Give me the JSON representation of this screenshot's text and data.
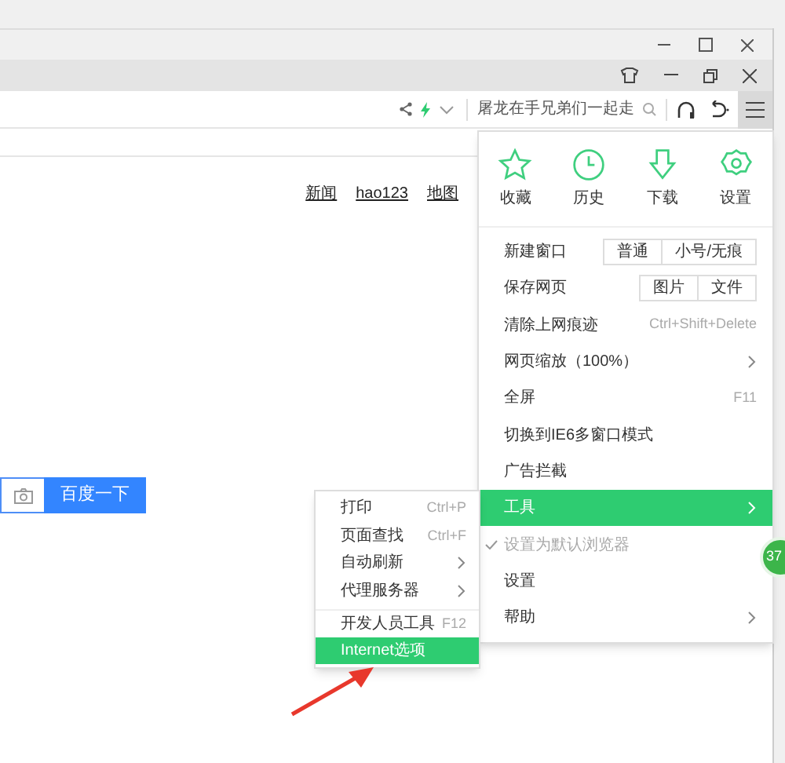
{
  "toolbar": {
    "search_text": "屠龙在手兄弟们一起走",
    "menu_button": {
      "selected": true
    }
  },
  "page": {
    "links": [
      "新闻",
      "hao123",
      "地图"
    ],
    "search_button": "百度一下"
  },
  "main_menu": {
    "shortcuts": [
      {
        "kind": "star",
        "label": "收藏"
      },
      {
        "kind": "clock",
        "label": "历史"
      },
      {
        "kind": "download",
        "label": "下载"
      },
      {
        "kind": "gear",
        "label": "设置"
      }
    ],
    "items": [
      {
        "label": "新建窗口",
        "buttons": [
          "普通",
          "小号/无痕"
        ],
        "selected": false
      },
      {
        "label": "保存网页",
        "buttons": [
          "图片",
          "文件"
        ],
        "selected": false
      },
      {
        "label": "清除上网痕迹",
        "shortcut": "Ctrl+Shift+Delete",
        "selected": false
      },
      {
        "label": "网页缩放（100%）",
        "submenu": true,
        "selected": false
      },
      {
        "label": "全屏",
        "shortcut": "F11",
        "selected": false
      },
      {
        "label": "切换到IE6多窗口模式",
        "selected": false
      },
      {
        "label": "广告拦截",
        "selected": false
      },
      {
        "label": "工具",
        "submenu": true,
        "selected": true
      },
      {
        "label": "设置为默认浏览器",
        "checked": true,
        "disabled": true,
        "selected": false
      },
      {
        "label": "设置",
        "selected": false
      },
      {
        "label": "帮助",
        "submenu": true,
        "selected": false
      }
    ]
  },
  "tools_submenu": {
    "items": [
      {
        "label": "打印",
        "shortcut": "Ctrl+P",
        "selected": false
      },
      {
        "label": "页面查找",
        "shortcut": "Ctrl+F",
        "selected": false
      },
      {
        "label": "自动刷新",
        "submenu": true,
        "selected": false
      },
      {
        "label": "代理服务器",
        "submenu": true,
        "selected": false
      },
      {
        "label": "开发人员工具",
        "shortcut": "F12",
        "separator_before": true,
        "selected": false
      },
      {
        "label": "Internet选项",
        "selected": true
      }
    ]
  },
  "badge": "37"
}
